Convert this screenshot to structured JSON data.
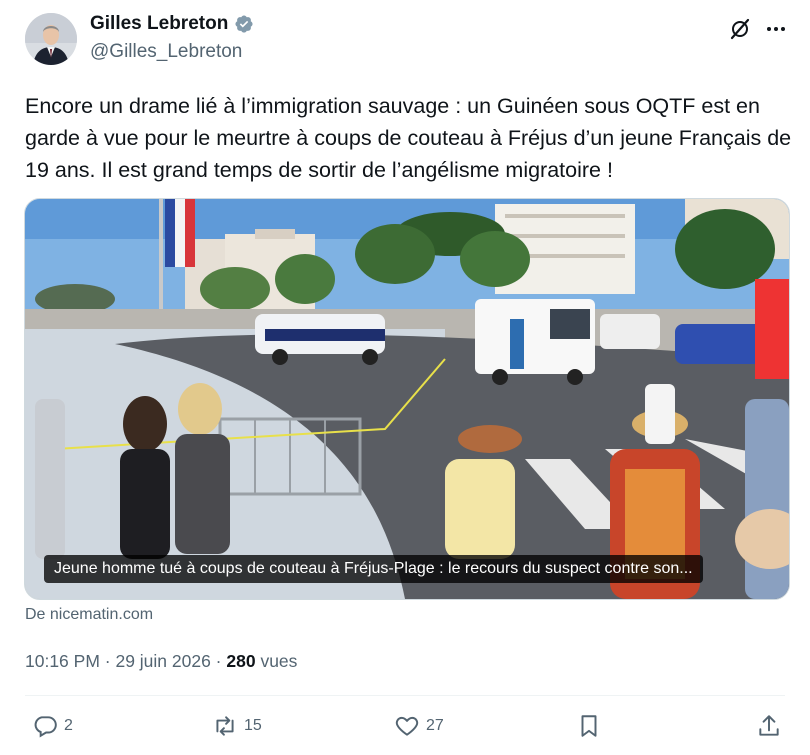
{
  "author": {
    "name": "Gilles Lebreton",
    "handle": "@Gilles_Lebreton"
  },
  "tweet": {
    "text": "Encore un drame lié à l’immigration sauvage : un Guinéen sous OQTF est en garde à vue pour le meurtre à coups de couteau à Fréjus d’un jeune Français de 19 ans. Il est grand temps de sortir de l’angélisme migratoire !"
  },
  "media": {
    "caption": "Jeune homme tué à coups de couteau à Fréjus-Plage : le recours du suspect contre son...",
    "source": "De nicematin.com"
  },
  "meta": {
    "time_date": "10:16 PM · 29 juin 2026 · ",
    "views_count": "280",
    "views_label": " vues"
  },
  "actions": {
    "replies": "2",
    "reposts": "15",
    "likes": "27"
  },
  "colors": {
    "text": "#0f1419",
    "secondary": "#536471",
    "verified": "#829aab"
  }
}
